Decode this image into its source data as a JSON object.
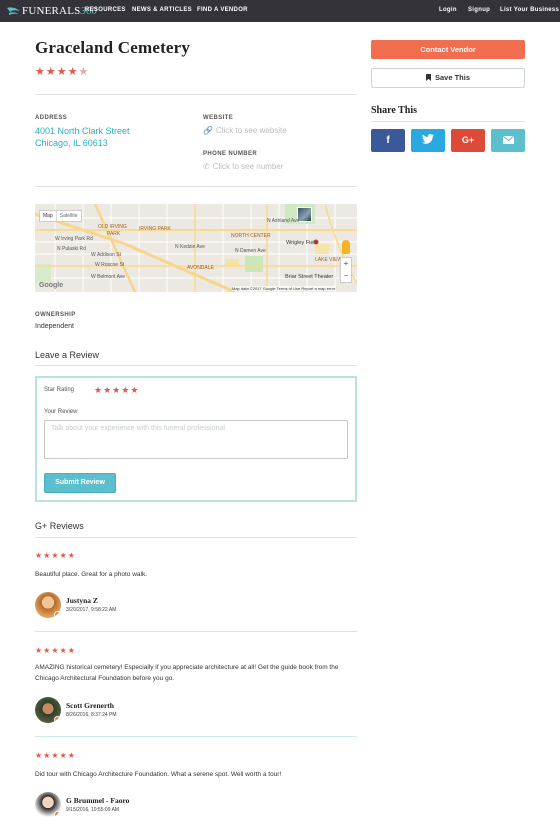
{
  "nav": {
    "logo_text": "FUNERALS",
    "logo_num": "360",
    "links": [
      "RESOURCES",
      "NEWS & ARTICLES",
      "FIND A VENDOR"
    ],
    "right_links": [
      "Login",
      "Signup",
      "List Your Business"
    ]
  },
  "vendor": {
    "name": "Graceland Cemetery",
    "rating": 4.5,
    "address_label": "ADDRESS",
    "address_line1": "4001 North Clark Street",
    "address_line2": "Chicago, IL 60613",
    "website_label": "WEBSITE",
    "website_text": "Click to see website",
    "phone_label": "PHONE NUMBER",
    "phone_text": "Click to see number",
    "ownership_label": "OWNERSHIP",
    "ownership_value": "Independent"
  },
  "map": {
    "toggle": [
      "Map",
      "Satellite"
    ],
    "labels": {
      "old_irving": "OLD IRVING",
      "park": "PARK",
      "irving_park": "IRVING PARK",
      "north_center": "NORTH CENTER",
      "wrigley": "Wrigley Field",
      "lake_view": "LAKE VIEW",
      "avondale": "AVONDALE",
      "briar": "Briar Street Theater",
      "w_irving": "W Irving Park Rd",
      "w_addison": "W Addison St",
      "w_belmont": "W Belmont Ave",
      "w_roscoe": "W Roscoe St",
      "n_pulaski": "N Pulaski Rd",
      "n_kedzie": "N Kedzie Ave",
      "n_damen": "N Damen Ave",
      "n_ashland": "N Ashland Ave"
    },
    "footer": "Map data ©2017 Google    Terms of Use    Report a map error",
    "google": "Google"
  },
  "review_form": {
    "heading": "Leave a Review",
    "star_label": "Star Rating",
    "review_label": "Your Review",
    "placeholder": "Talk about your experience with this funeral professional.",
    "submit": "Submit Review"
  },
  "reviews_heading": "G+ Reviews",
  "reviews": [
    {
      "stars": 5,
      "text": "Beautiful place. Great for a photo walk.",
      "author": "Justyna Z",
      "date": "3/20/2017, 9:58:22 AM"
    },
    {
      "stars": 5,
      "text": "AMAZING historical cemetery! Especially if you appreciate architecture at all! Get the guide book from the Chicago Architectural Foundation before you go.",
      "author": "Scott Grenerth",
      "date": "8/26/2016, 8:37:24 PM"
    },
    {
      "stars": 5,
      "text": "Did tour with Chicago Architecture Foundation. What a serene spot. Well worth a tour!",
      "author": "G Brummel - Faoro",
      "date": "9/15/2016, 10:55:09 AM"
    }
  ],
  "sidebar": {
    "contact": "Contact Vendor",
    "save": "Save This",
    "share_title": "Share This",
    "share_buttons": [
      {
        "icon": "facebook-icon",
        "glyph": "f",
        "color": "#3b5998"
      },
      {
        "icon": "twitter-icon",
        "glyph": "🐦",
        "color": "#2aa9e0"
      },
      {
        "icon": "google-plus-icon",
        "glyph": "G+",
        "color": "#dc4a38"
      },
      {
        "icon": "email-icon",
        "glyph": "✉",
        "color": "#5bbfcd"
      }
    ]
  },
  "colors": {
    "accent": "#2ab0c4",
    "star": "#e05a47",
    "cta": "#f26c4f",
    "nav_bg": "#34333a"
  }
}
